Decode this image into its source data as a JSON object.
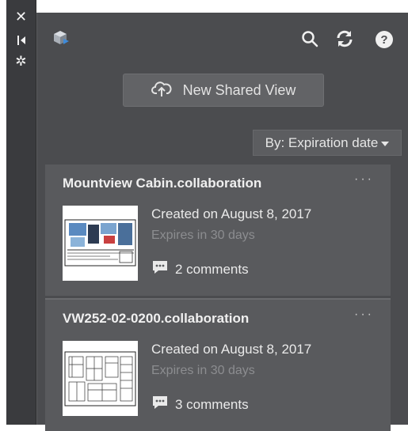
{
  "panel": {
    "new_button_label": "New Shared View",
    "sort_label": "By: Expiration date"
  },
  "sidebar": {
    "icons": [
      "close-icon",
      "pin-icon",
      "gear-icon"
    ]
  },
  "toolbar": {
    "icons": [
      "search-icon",
      "refresh-icon",
      "help-icon"
    ]
  },
  "views": [
    {
      "title": "Mountview Cabin.collaboration",
      "created": "Created on August 8, 2017",
      "expires": "Expires in 30 days",
      "comments": "2 comments",
      "more": "···"
    },
    {
      "title": "VW252-02-0200.collaboration",
      "created": "Created on August 8, 2017",
      "expires": "Expires in 30 days",
      "comments": "3 comments",
      "more": "···"
    }
  ],
  "colors": {
    "panel_bg": "#4b4c4f",
    "card_bg": "#595a5d",
    "sidebar_bg": "#3a3b3e",
    "muted_text": "#8c8d90"
  }
}
